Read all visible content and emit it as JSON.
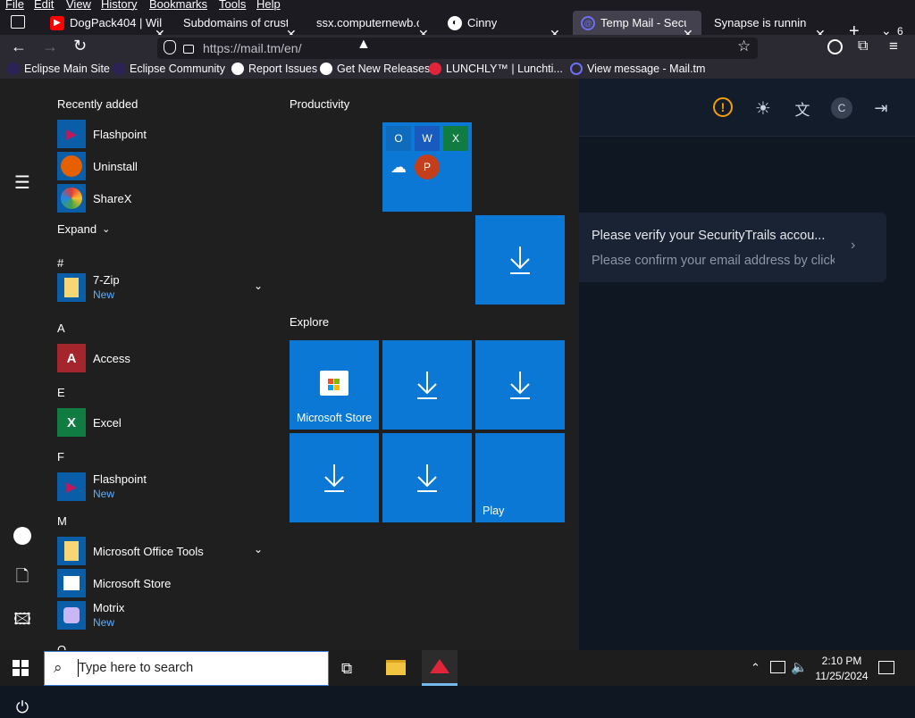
{
  "menubar": {
    "items": [
      "File",
      "Edit",
      "View",
      "History",
      "Bookmarks",
      "Tools",
      "Help"
    ]
  },
  "tabs": [
    {
      "label": "DogPack404 | Wil",
      "favicon_color": "#ff0000"
    },
    {
      "label": "Subdomains of crusty",
      "favicon_color": ""
    },
    {
      "label": "ssx.computernewb.cc",
      "favicon_color": ""
    },
    {
      "label": "Cinny",
      "favicon_color": "#ffffff"
    },
    {
      "label": "Temp Mail - Secu",
      "favicon_color": "#6e6ef5"
    },
    {
      "label": "Synapse is running",
      "favicon_color": ""
    }
  ],
  "tab_overflow_count": "6",
  "url": {
    "text": "https://mail.tm/en/"
  },
  "bookmarks": [
    {
      "label": "Eclipse Main Site",
      "color": "#2c2255"
    },
    {
      "label": "Eclipse Community",
      "color": "#2c2255"
    },
    {
      "label": "Report Issues",
      "color": "#ffffff"
    },
    {
      "label": "Get New Releases",
      "color": "#ffffff"
    },
    {
      "label": "LUNCHLY™ | Lunchti...",
      "color": "#e0253a"
    },
    {
      "label": "View message - Mail.tm",
      "color": "#6e6ef5"
    }
  ],
  "mailtm": {
    "avatar_letter": "C",
    "message": {
      "subject": "Please verify your SecurityTrails accou...",
      "preview": "Please confirm your email address by clicking"
    }
  },
  "startmenu": {
    "recently_added_label": "Recently added",
    "recent": [
      {
        "name": "Flashpoint",
        "icon_color": "#0a5ea8"
      },
      {
        "name": "Uninstall",
        "icon_color": "#0a5ea8"
      },
      {
        "name": "ShareX",
        "icon_color": "#0a5ea8"
      }
    ],
    "expand_label": "Expand",
    "groups": [
      {
        "letter": "#",
        "apps": [
          {
            "name": "7-Zip",
            "badge": "New"
          }
        ]
      },
      {
        "letter": "A",
        "apps": [
          {
            "name": "Access",
            "badge": ""
          }
        ]
      },
      {
        "letter": "E",
        "apps": [
          {
            "name": "Excel",
            "badge": ""
          }
        ]
      },
      {
        "letter": "F",
        "apps": [
          {
            "name": "Flashpoint",
            "badge": "New"
          }
        ]
      },
      {
        "letter": "M",
        "apps": [
          {
            "name": "Microsoft Office Tools",
            "badge": ""
          },
          {
            "name": "Microsoft Store",
            "badge": ""
          },
          {
            "name": "Motrix",
            "badge": "New"
          }
        ]
      }
    ],
    "partial_letter": "O",
    "productivity_label": "Productivity",
    "explore_label": "Explore",
    "tiles": {
      "office_apps": [
        "O",
        "W",
        "X",
        "",
        "P"
      ],
      "microsoft_store": "Microsoft Store",
      "play": "Play"
    }
  },
  "taskbar": {
    "search_placeholder": "Type here to search",
    "time": "2:10 PM",
    "date": "11/25/2024"
  },
  "colors": {
    "accent": "#0a78d4",
    "start_bg": "#1f1f1f",
    "page_bg": "#0f1722",
    "new_badge": "#5aaefc"
  }
}
